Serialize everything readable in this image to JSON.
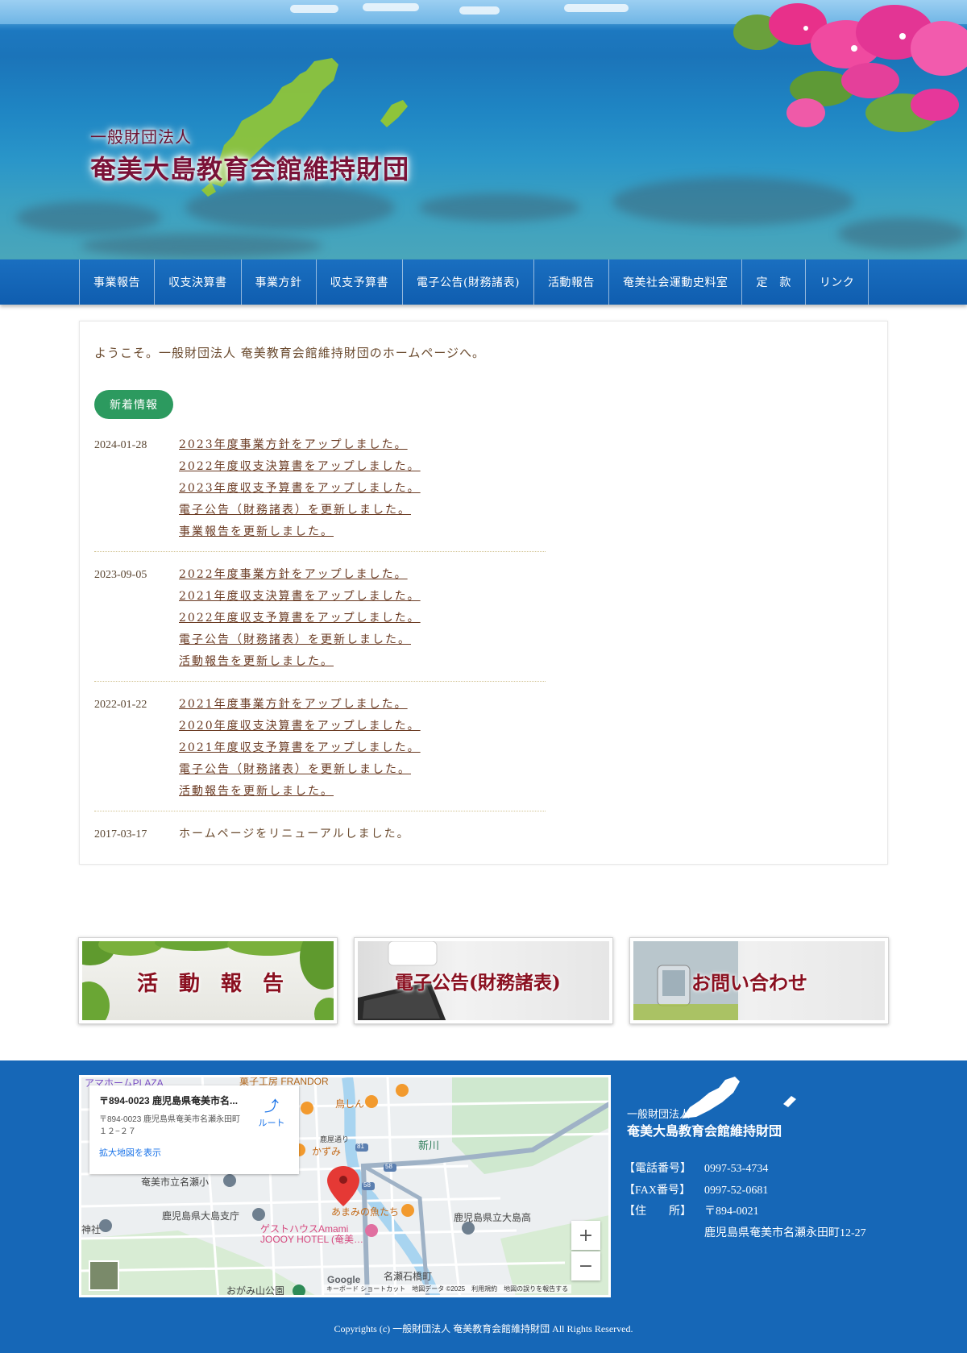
{
  "header": {
    "org_type": "一般財団法人",
    "org_name": "奄美大島教育会館維持財団"
  },
  "nav": {
    "items": [
      "事業報告",
      "収支決算書",
      "事業方針",
      "収支予算書",
      "電子公告(財務諸表)",
      "活動報告",
      "奄美社会運動史料室",
      "定　款",
      "リンク"
    ]
  },
  "main": {
    "welcome": "ようこそ。一般財団法人 奄美教育会館維持財団のホームページへ。",
    "badge": "新着情報",
    "news": [
      {
        "date": "2024-01-28",
        "items": [
          "2023年度事業方針をアップしました。",
          "2022年度収支決算書をアップしました。",
          "2023年度収支予算書をアップしました。",
          "電子公告（財務諸表）を更新しました。",
          "事業報告を更新しました。"
        ]
      },
      {
        "date": "2023-09-05",
        "items": [
          "2022年度事業方針をアップしました。",
          "2021年度収支決算書をアップしました。",
          "2022年度収支予算書をアップしました。",
          "電子公告（財務諸表）を更新しました。",
          "活動報告を更新しました。"
        ]
      },
      {
        "date": "2022-01-22",
        "items": [
          "2021年度事業方針をアップしました。",
          "2020年度収支決算書をアップしました。",
          "2021年度収支予算書をアップしました。",
          "電子公告（財務諸表）を更新しました。",
          "活動報告を更新しました。"
        ]
      },
      {
        "date": "2017-03-17",
        "text": "ホームページをリニューアルしました。"
      }
    ]
  },
  "banners": {
    "activity": "活　動　報　告",
    "notice": "電子公告(財務諸表)",
    "contact": "お問い合わせ"
  },
  "map": {
    "card_title": "〒894-0023 鹿児島県奄美市名...",
    "card_address": "〒894-0023 鹿児島県奄美市名瀬永田町１２−２７",
    "card_link": "拡大地図を表示",
    "route": "ルート",
    "labels": [
      "アマホームPLAZA",
      "菓子工房 FRANDOR",
      "鳥しん",
      "かずみ",
      "新川",
      "奄美市立名瀬小",
      "鹿児島県大島支庁",
      "あまみの魚たち",
      "鹿児島県立大島高",
      "ゲストハウスAmami JOOOY HOTEL (奄美…",
      "神社",
      "名瀬石橋町",
      "おがみ山公園",
      "鹿屋通り"
    ],
    "road_numbers": [
      "81",
      "58",
      "58"
    ],
    "google": "Google",
    "attribution": "キーボード ショートカット　地図データ ©2025　利用規約　地図の誤りを報告する",
    "zoom_in": "+",
    "zoom_out": "−"
  },
  "footer": {
    "org_type": "一般財団法人",
    "org_name": "奄美大島教育会館維持財団",
    "tel_label": "【電話番号】",
    "tel": "0997-53-4734",
    "fax_label": "【FAX番号】",
    "fax": "0997-52-0681",
    "addr_label": "【住　　所】",
    "postal": "〒894-0021",
    "address": "鹿児島県奄美市名瀬永田町12-27",
    "copyright": "Copyrights (c) 一般財団法人 奄美教育会館維持財団 All Rights Reserved."
  },
  "colors": {
    "nav_bg": "#1167b9",
    "badge": "#2c9a5f",
    "footer_bg": "#1667b7",
    "logo_text": "#7a1238"
  }
}
